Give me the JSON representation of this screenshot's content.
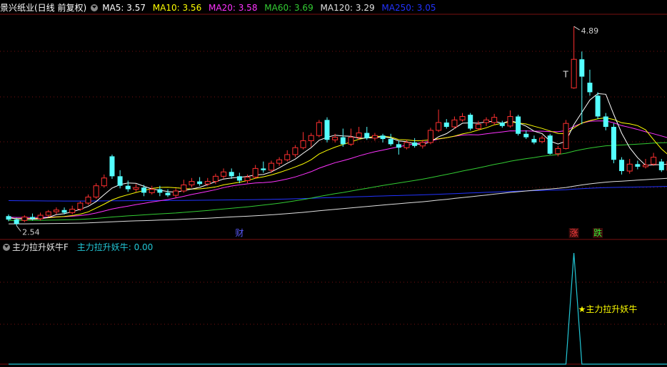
{
  "main_header": {
    "title": "景兴纸业(日线 前复权)",
    "ma5": "MA5: 3.57",
    "ma10": "MA10: 3.56",
    "ma20": "MA20: 3.58",
    "ma60": "MA60: 3.69",
    "ma120": "MA120: 3.29",
    "ma250": "MA250: 3.05"
  },
  "sub_header": {
    "title": "主力拉升妖牛F",
    "value": "主力拉升妖牛: 0.00"
  },
  "colors": {
    "background": "#000000",
    "up_candle": "#ff3030",
    "down_candle": "#54ffff",
    "ma5": "#ffffff",
    "ma10": "#ffff00",
    "ma20": "#ff33ff",
    "ma60": "#33cc33",
    "ma120": "#e0e0e0",
    "ma250": "#2233ff",
    "grid": "#7a1010",
    "signal": "#22c7d6",
    "signal_label": "#ffff00"
  },
  "chart_data": [
    {
      "type": "candlestick",
      "title": "景兴纸业(日线 前复权)",
      "ylim": [
        2.45,
        5.0
      ],
      "high_label": "4.89",
      "low_label": "2.54",
      "markers": [
        {
          "label": "财",
          "index": 29,
          "color": "#5a5aff"
        },
        {
          "label": "涨",
          "index": 71,
          "color": "#ff4040"
        },
        {
          "label": "跌",
          "index": 74,
          "color": "#33ee33"
        }
      ],
      "t_marker": {
        "label": "T",
        "index": 70,
        "price": 4.27
      },
      "candles": [
        [
          2.67,
          2.63,
          2.69,
          2.61
        ],
        [
          2.63,
          2.58,
          2.65,
          2.56
        ],
        [
          2.62,
          2.66,
          2.68,
          2.6
        ],
        [
          2.66,
          2.64,
          2.7,
          2.62
        ],
        [
          2.64,
          2.68,
          2.71,
          2.62
        ],
        [
          2.68,
          2.72,
          2.74,
          2.66
        ],
        [
          2.72,
          2.74,
          2.77,
          2.69
        ],
        [
          2.74,
          2.71,
          2.77,
          2.69
        ],
        [
          2.71,
          2.75,
          2.79,
          2.69
        ],
        [
          2.75,
          2.82,
          2.84,
          2.73
        ],
        [
          2.82,
          2.89,
          2.92,
          2.8
        ],
        [
          2.89,
          3.02,
          3.05,
          2.87
        ],
        [
          3.02,
          3.11,
          3.15,
          3.0
        ],
        [
          3.36,
          3.13,
          3.38,
          3.1
        ],
        [
          3.13,
          3.02,
          3.2,
          2.99
        ],
        [
          3.02,
          2.98,
          3.08,
          2.95
        ],
        [
          2.98,
          3.0,
          3.04,
          2.95
        ],
        [
          3.0,
          2.94,
          3.03,
          2.9
        ],
        [
          2.94,
          2.98,
          3.02,
          2.92
        ],
        [
          2.98,
          2.94,
          3.02,
          2.9
        ],
        [
          2.94,
          2.91,
          2.98,
          2.89
        ],
        [
          2.91,
          2.96,
          2.99,
          2.88
        ],
        [
          2.96,
          3.03,
          3.09,
          2.94
        ],
        [
          3.03,
          3.07,
          3.11,
          3.0
        ],
        [
          3.07,
          3.04,
          3.12,
          3.02
        ],
        [
          3.04,
          3.07,
          3.11,
          3.02
        ],
        [
          3.07,
          3.13,
          3.16,
          3.04
        ],
        [
          3.13,
          3.18,
          3.22,
          3.1
        ],
        [
          3.18,
          3.13,
          3.22,
          3.1
        ],
        [
          3.13,
          3.08,
          3.17,
          3.05
        ],
        [
          3.08,
          3.12,
          3.15,
          3.05
        ],
        [
          3.12,
          3.22,
          3.26,
          3.1
        ],
        [
          3.22,
          3.2,
          3.3,
          3.17
        ],
        [
          3.2,
          3.28,
          3.31,
          3.17
        ],
        [
          3.28,
          3.32,
          3.35,
          3.25
        ],
        [
          3.32,
          3.38,
          3.43,
          3.3
        ],
        [
          3.38,
          3.46,
          3.49,
          3.35
        ],
        [
          3.46,
          3.54,
          3.64,
          3.44
        ],
        [
          3.54,
          3.6,
          3.63,
          3.47
        ],
        [
          3.6,
          3.75,
          3.78,
          3.58
        ],
        [
          3.78,
          3.55,
          3.81,
          3.52
        ],
        [
          3.55,
          3.58,
          3.62,
          3.52
        ],
        [
          3.58,
          3.5,
          3.68,
          3.47
        ],
        [
          3.5,
          3.58,
          3.68,
          3.48
        ],
        [
          3.58,
          3.63,
          3.7,
          3.55
        ],
        [
          3.63,
          3.57,
          3.7,
          3.55
        ],
        [
          3.57,
          3.6,
          3.63,
          3.54
        ],
        [
          3.6,
          3.56,
          3.62,
          3.52
        ],
        [
          3.56,
          3.5,
          3.62,
          3.48
        ],
        [
          3.5,
          3.46,
          3.54,
          3.38
        ],
        [
          3.46,
          3.52,
          3.55,
          3.44
        ],
        [
          3.52,
          3.48,
          3.57,
          3.46
        ],
        [
          3.48,
          3.52,
          3.55,
          3.45
        ],
        [
          3.52,
          3.66,
          3.69,
          3.5
        ],
        [
          3.66,
          3.75,
          3.9,
          3.64
        ],
        [
          3.75,
          3.7,
          3.79,
          3.68
        ],
        [
          3.7,
          3.78,
          3.82,
          3.68
        ],
        [
          3.78,
          3.82,
          3.86,
          3.76
        ],
        [
          3.84,
          3.68,
          3.86,
          3.66
        ],
        [
          3.68,
          3.73,
          3.77,
          3.66
        ],
        [
          3.75,
          3.78,
          3.81,
          3.71
        ],
        [
          3.75,
          3.81,
          3.85,
          3.72
        ],
        [
          3.75,
          3.71,
          3.77,
          3.69
        ],
        [
          3.71,
          3.82,
          3.89,
          3.69
        ],
        [
          3.82,
          3.62,
          3.84,
          3.6
        ],
        [
          3.62,
          3.58,
          3.66,
          3.56
        ],
        [
          3.56,
          3.52,
          3.6,
          3.5
        ],
        [
          3.53,
          3.57,
          3.6,
          3.51
        ],
        [
          3.6,
          3.39,
          3.62,
          3.38
        ],
        [
          3.39,
          3.45,
          3.48,
          3.36
        ],
        [
          3.45,
          3.74,
          3.78,
          3.44
        ],
        [
          4.15,
          4.48,
          4.86,
          4.14
        ],
        [
          4.48,
          4.28,
          4.57,
          3.73
        ],
        [
          4.21,
          4.1,
          4.36,
          4.06
        ],
        [
          4.06,
          3.82,
          4.1,
          3.79
        ],
        [
          3.82,
          3.7,
          3.86,
          3.66
        ],
        [
          3.7,
          3.32,
          3.74,
          3.28
        ],
        [
          3.32,
          3.19,
          3.35,
          3.15
        ],
        [
          3.19,
          3.27,
          3.33,
          3.16
        ],
        [
          3.27,
          3.24,
          3.31,
          3.21
        ],
        [
          3.24,
          3.26,
          3.33,
          3.22
        ],
        [
          3.27,
          3.35,
          3.4,
          3.25
        ],
        [
          3.3,
          3.2,
          3.33,
          3.18
        ],
        [
          3.2,
          3.3,
          3.38,
          3.18
        ],
        [
          3.3,
          3.42,
          3.48,
          3.28
        ]
      ]
    },
    {
      "type": "line",
      "title": "主力拉升妖牛",
      "series": [
        {
          "name": "主力拉升妖牛",
          "values": "zero except single spike of 1 at candle index 71"
        }
      ],
      "spike_index": 71,
      "spike_value": 1,
      "spike_label": "★主力拉升妖牛"
    }
  ]
}
